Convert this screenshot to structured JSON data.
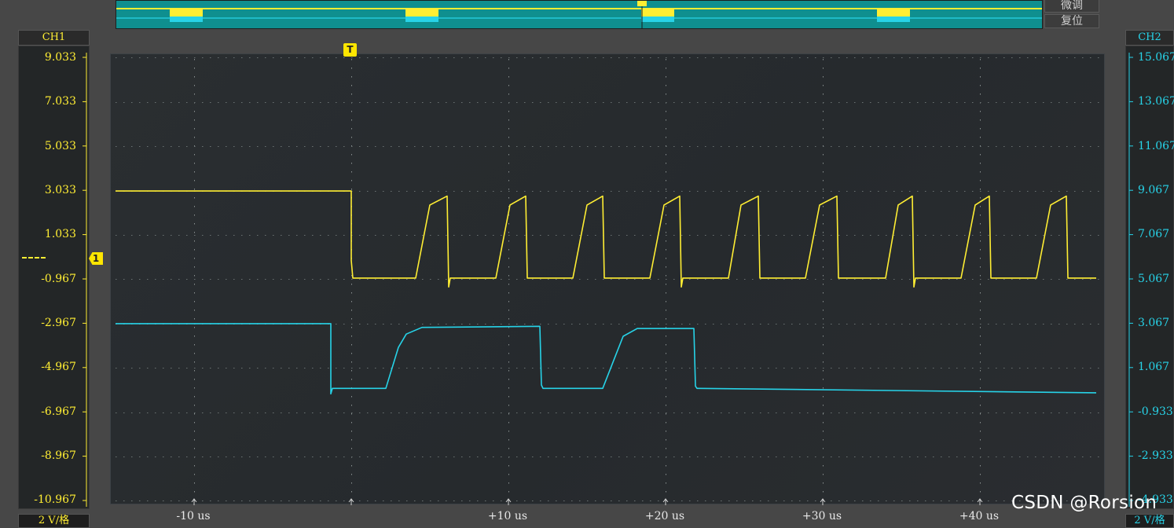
{
  "overview": {
    "fine_label": "微调",
    "reset_label": "复位"
  },
  "channels": {
    "ch1": {
      "name": "CH1",
      "color": "#ffee33",
      "scale": "2 V/格",
      "ticks": [
        "9.033",
        "7.033",
        "5.033",
        "3.033",
        "1.033",
        "-0.967",
        "-2.967",
        "-4.967",
        "-6.967",
        "-8.967",
        "-10.967"
      ]
    },
    "ch2": {
      "name": "CH2",
      "color": "#27d3e8",
      "scale": "2 V/格",
      "ticks": [
        "15.067",
        "13.067",
        "11.067",
        "9.067",
        "7.067",
        "5.067",
        "3.067",
        "1.067",
        "-0.933",
        "-2.933",
        "-4.933"
      ]
    }
  },
  "time_axis": {
    "labels": [
      "-10 us",
      "+10 us",
      "+20 us",
      "+30 us",
      "+40 us"
    ]
  },
  "markers": {
    "trigger": "T",
    "ch1_level": "1"
  },
  "chart_data": {
    "type": "line",
    "xlabel": "",
    "ylabel": "",
    "xlim": [
      -15,
      48
    ],
    "x_unit": "us",
    "grid": true,
    "series": [
      {
        "name": "CH1",
        "color": "#ffee33",
        "axis": "left",
        "x": [
          -15,
          0,
          0,
          0.1,
          4.1,
          5.0,
          6.1,
          6.2,
          6.3,
          9.2,
          10.1,
          11.1,
          11.2,
          14.1,
          15.0,
          16.0,
          16.1,
          19.0,
          19.9,
          20.9,
          21.0,
          21.1,
          24.0,
          24.8,
          25.9,
          26.0,
          28.9,
          29.8,
          30.9,
          31.0,
          34.0,
          34.8,
          35.7,
          35.8,
          35.9,
          38.8,
          39.7,
          40.6,
          40.7,
          43.6,
          44.5,
          45.5,
          45.6,
          47.4
        ],
        "values": [
          3.03,
          3.03,
          -0.1,
          -0.9,
          -0.9,
          2.4,
          2.8,
          -1.3,
          -0.9,
          -0.9,
          2.4,
          2.8,
          -0.9,
          -0.9,
          2.4,
          2.8,
          -0.9,
          -0.9,
          2.4,
          2.8,
          -1.3,
          -0.9,
          -0.9,
          2.4,
          2.8,
          -0.9,
          -0.9,
          2.4,
          2.8,
          -0.9,
          -0.9,
          2.4,
          2.8,
          -1.3,
          -0.9,
          -0.9,
          2.4,
          2.8,
          -0.9,
          -0.9,
          2.4,
          2.8,
          -0.9,
          -0.9
        ]
      },
      {
        "name": "CH2",
        "color": "#27d3e8",
        "axis": "right",
        "x": [
          -15,
          -1.3,
          -1.3,
          -1.2,
          2.2,
          3.0,
          3.5,
          4.5,
          12.0,
          12.1,
          12.2,
          16.0,
          16.8,
          17.3,
          18.2,
          21.8,
          21.9,
          22.0,
          47.4
        ],
        "values": [
          3.07,
          3.07,
          -0.1,
          0.15,
          0.15,
          2.0,
          2.6,
          2.9,
          2.95,
          0.3,
          0.15,
          0.15,
          1.6,
          2.5,
          2.85,
          2.85,
          0.25,
          0.15,
          -0.05
        ]
      }
    ]
  }
}
